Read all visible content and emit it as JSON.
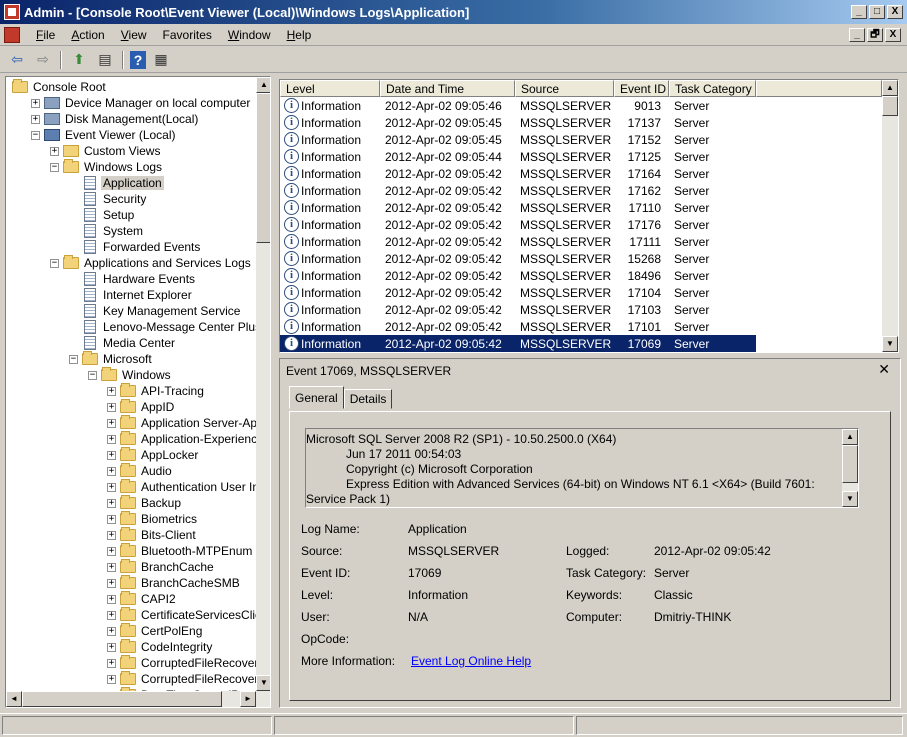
{
  "window": {
    "title": "Admin - [Console Root\\Event Viewer (Local)\\Windows Logs\\Application]",
    "minimize": "_",
    "maximize": "□",
    "close": "X",
    "doc_restore": "🗗",
    "doc_close": "X"
  },
  "menu": [
    {
      "label": "File",
      "accel": "F",
      "rest": "ile"
    },
    {
      "label": "Action",
      "accel": "A",
      "rest": "ction"
    },
    {
      "label": "View",
      "accel": "V",
      "rest": "iew"
    },
    {
      "label": "Favorites",
      "accel": "",
      "rest": "Favorites"
    },
    {
      "label": "Window",
      "accel": "W",
      "rest": "indow"
    },
    {
      "label": "Help",
      "accel": "H",
      "rest": "elp"
    }
  ],
  "toolbar": {
    "back_glyph": "⇦",
    "forward_glyph": "⇨",
    "up_glyph": "⬆",
    "showhide_glyph": "▤",
    "help_glyph": "?",
    "props_glyph": "▦"
  },
  "tree": [
    {
      "label": "Console Root",
      "level": 0,
      "expander": "",
      "icon": "folder"
    },
    {
      "label": "Device Manager on local computer",
      "level": 1,
      "expander": "+",
      "icon": "mgmt"
    },
    {
      "label": "Disk Management(Local)",
      "level": 1,
      "expander": "+",
      "icon": "mgmt"
    },
    {
      "label": "Event Viewer (Local)",
      "level": 1,
      "expander": "−",
      "icon": "eventviewer"
    },
    {
      "label": "Custom Views",
      "level": 2,
      "expander": "+",
      "icon": "filter"
    },
    {
      "label": "Windows Logs",
      "level": 2,
      "expander": "−",
      "icon": "folder"
    },
    {
      "label": "Application",
      "level": 3,
      "expander": "",
      "icon": "log",
      "selected": true
    },
    {
      "label": "Security",
      "level": 3,
      "expander": "",
      "icon": "log"
    },
    {
      "label": "Setup",
      "level": 3,
      "expander": "",
      "icon": "log"
    },
    {
      "label": "System",
      "level": 3,
      "expander": "",
      "icon": "log"
    },
    {
      "label": "Forwarded Events",
      "level": 3,
      "expander": "",
      "icon": "log"
    },
    {
      "label": "Applications and Services Logs",
      "level": 2,
      "expander": "−",
      "icon": "folder"
    },
    {
      "label": "Hardware Events",
      "level": 3,
      "expander": "",
      "icon": "log"
    },
    {
      "label": "Internet Explorer",
      "level": 3,
      "expander": "",
      "icon": "log"
    },
    {
      "label": "Key Management Service",
      "level": 3,
      "expander": "",
      "icon": "log"
    },
    {
      "label": "Lenovo-Message Center Plus/Admin",
      "level": 3,
      "expander": "",
      "icon": "log"
    },
    {
      "label": "Media Center",
      "level": 3,
      "expander": "",
      "icon": "log"
    },
    {
      "label": "Microsoft",
      "level": 3,
      "expander": "−",
      "icon": "folder"
    },
    {
      "label": "Windows",
      "level": 4,
      "expander": "−",
      "icon": "folder"
    },
    {
      "label": "API-Tracing",
      "level": 5,
      "expander": "+",
      "icon": "folder"
    },
    {
      "label": "AppID",
      "level": 5,
      "expander": "+",
      "icon": "folder"
    },
    {
      "label": "Application Server-Applications",
      "level": 5,
      "expander": "+",
      "icon": "folder"
    },
    {
      "label": "Application-Experience",
      "level": 5,
      "expander": "+",
      "icon": "folder"
    },
    {
      "label": "AppLocker",
      "level": 5,
      "expander": "+",
      "icon": "folder"
    },
    {
      "label": "Audio",
      "level": 5,
      "expander": "+",
      "icon": "folder"
    },
    {
      "label": "Authentication User Interface",
      "level": 5,
      "expander": "+",
      "icon": "folder"
    },
    {
      "label": "Backup",
      "level": 5,
      "expander": "+",
      "icon": "folder"
    },
    {
      "label": "Biometrics",
      "level": 5,
      "expander": "+",
      "icon": "folder"
    },
    {
      "label": "Bits-Client",
      "level": 5,
      "expander": "+",
      "icon": "folder"
    },
    {
      "label": "Bluetooth-MTPEnum",
      "level": 5,
      "expander": "+",
      "icon": "folder"
    },
    {
      "label": "BranchCache",
      "level": 5,
      "expander": "+",
      "icon": "folder"
    },
    {
      "label": "BranchCacheSMB",
      "level": 5,
      "expander": "+",
      "icon": "folder"
    },
    {
      "label": "CAPI2",
      "level": 5,
      "expander": "+",
      "icon": "folder"
    },
    {
      "label": "CertificateServicesClient-CredentialRoaming",
      "level": 5,
      "expander": "+",
      "icon": "folder"
    },
    {
      "label": "CertPolEng",
      "level": 5,
      "expander": "+",
      "icon": "folder"
    },
    {
      "label": "CodeIntegrity",
      "level": 5,
      "expander": "+",
      "icon": "folder"
    },
    {
      "label": "CorruptedFileRecovery-Client",
      "level": 5,
      "expander": "+",
      "icon": "folder"
    },
    {
      "label": "CorruptedFileRecovery-Server",
      "level": 5,
      "expander": "+",
      "icon": "folder"
    },
    {
      "label": "DateTimeControlPanel",
      "level": 5,
      "expander": "+",
      "icon": "folder"
    }
  ],
  "scroll": {
    "up": "▲",
    "down": "▼",
    "left": "◄",
    "right": "►"
  },
  "grid": {
    "columns": [
      "Level",
      "Date and Time",
      "Source",
      "Event ID",
      "Task Category"
    ],
    "info_glyph": "i",
    "rows": [
      {
        "level": "Information",
        "date": "2012-Apr-02 09:05:46",
        "source": "MSSQLSERVER",
        "id": "9013",
        "category": "Server"
      },
      {
        "level": "Information",
        "date": "2012-Apr-02 09:05:45",
        "source": "MSSQLSERVER",
        "id": "17137",
        "category": "Server"
      },
      {
        "level": "Information",
        "date": "2012-Apr-02 09:05:45",
        "source": "MSSQLSERVER",
        "id": "17152",
        "category": "Server"
      },
      {
        "level": "Information",
        "date": "2012-Apr-02 09:05:44",
        "source": "MSSQLSERVER",
        "id": "17125",
        "category": "Server"
      },
      {
        "level": "Information",
        "date": "2012-Apr-02 09:05:42",
        "source": "MSSQLSERVER",
        "id": "17164",
        "category": "Server"
      },
      {
        "level": "Information",
        "date": "2012-Apr-02 09:05:42",
        "source": "MSSQLSERVER",
        "id": "17162",
        "category": "Server"
      },
      {
        "level": "Information",
        "date": "2012-Apr-02 09:05:42",
        "source": "MSSQLSERVER",
        "id": "17110",
        "category": "Server"
      },
      {
        "level": "Information",
        "date": "2012-Apr-02 09:05:42",
        "source": "MSSQLSERVER",
        "id": "17176",
        "category": "Server"
      },
      {
        "level": "Information",
        "date": "2012-Apr-02 09:05:42",
        "source": "MSSQLSERVER",
        "id": "17111",
        "category": "Server"
      },
      {
        "level": "Information",
        "date": "2012-Apr-02 09:05:42",
        "source": "MSSQLSERVER",
        "id": "15268",
        "category": "Server"
      },
      {
        "level": "Information",
        "date": "2012-Apr-02 09:05:42",
        "source": "MSSQLSERVER",
        "id": "18496",
        "category": "Server"
      },
      {
        "level": "Information",
        "date": "2012-Apr-02 09:05:42",
        "source": "MSSQLSERVER",
        "id": "17104",
        "category": "Server"
      },
      {
        "level": "Information",
        "date": "2012-Apr-02 09:05:42",
        "source": "MSSQLSERVER",
        "id": "17103",
        "category": "Server"
      },
      {
        "level": "Information",
        "date": "2012-Apr-02 09:05:42",
        "source": "MSSQLSERVER",
        "id": "17101",
        "category": "Server"
      },
      {
        "level": "Information",
        "date": "2012-Apr-02 09:05:42",
        "source": "MSSQLSERVER",
        "id": "17069",
        "category": "Server",
        "selected": true
      }
    ]
  },
  "detail": {
    "title": "Event 17069, MSSQLSERVER",
    "close": "✕",
    "tabs": [
      "General",
      "Details"
    ],
    "message_lines": [
      "Microsoft SQL Server 2008 R2 (SP1) - 10.50.2500.0 (X64)",
      "            Jun 17 2011 00:54:03",
      "            Copyright (c) Microsoft Corporation",
      "            Express Edition with Advanced Services (64-bit) on Windows NT 6.1 <X64> (Build 7601:",
      "Service Pack 1)"
    ],
    "labels": {
      "log_name": "Log Name:",
      "source": "Source:",
      "event_id": "Event ID:",
      "level": "Level:",
      "user": "User:",
      "opcode": "OpCode:",
      "more_info": "More Information:",
      "logged": "Logged:",
      "task_category": "Task Category:",
      "keywords": "Keywords:",
      "computer": "Computer:"
    },
    "values": {
      "log_name": "Application",
      "source": "MSSQLSERVER",
      "event_id": "17069",
      "level": "Information",
      "user": "N/A",
      "opcode": "",
      "more_info_link": "Event Log Online Help",
      "logged": "2012-Apr-02 09:05:42",
      "task_category": "Server",
      "keywords": "Classic",
      "computer": "Dmitriy-THINK"
    }
  }
}
